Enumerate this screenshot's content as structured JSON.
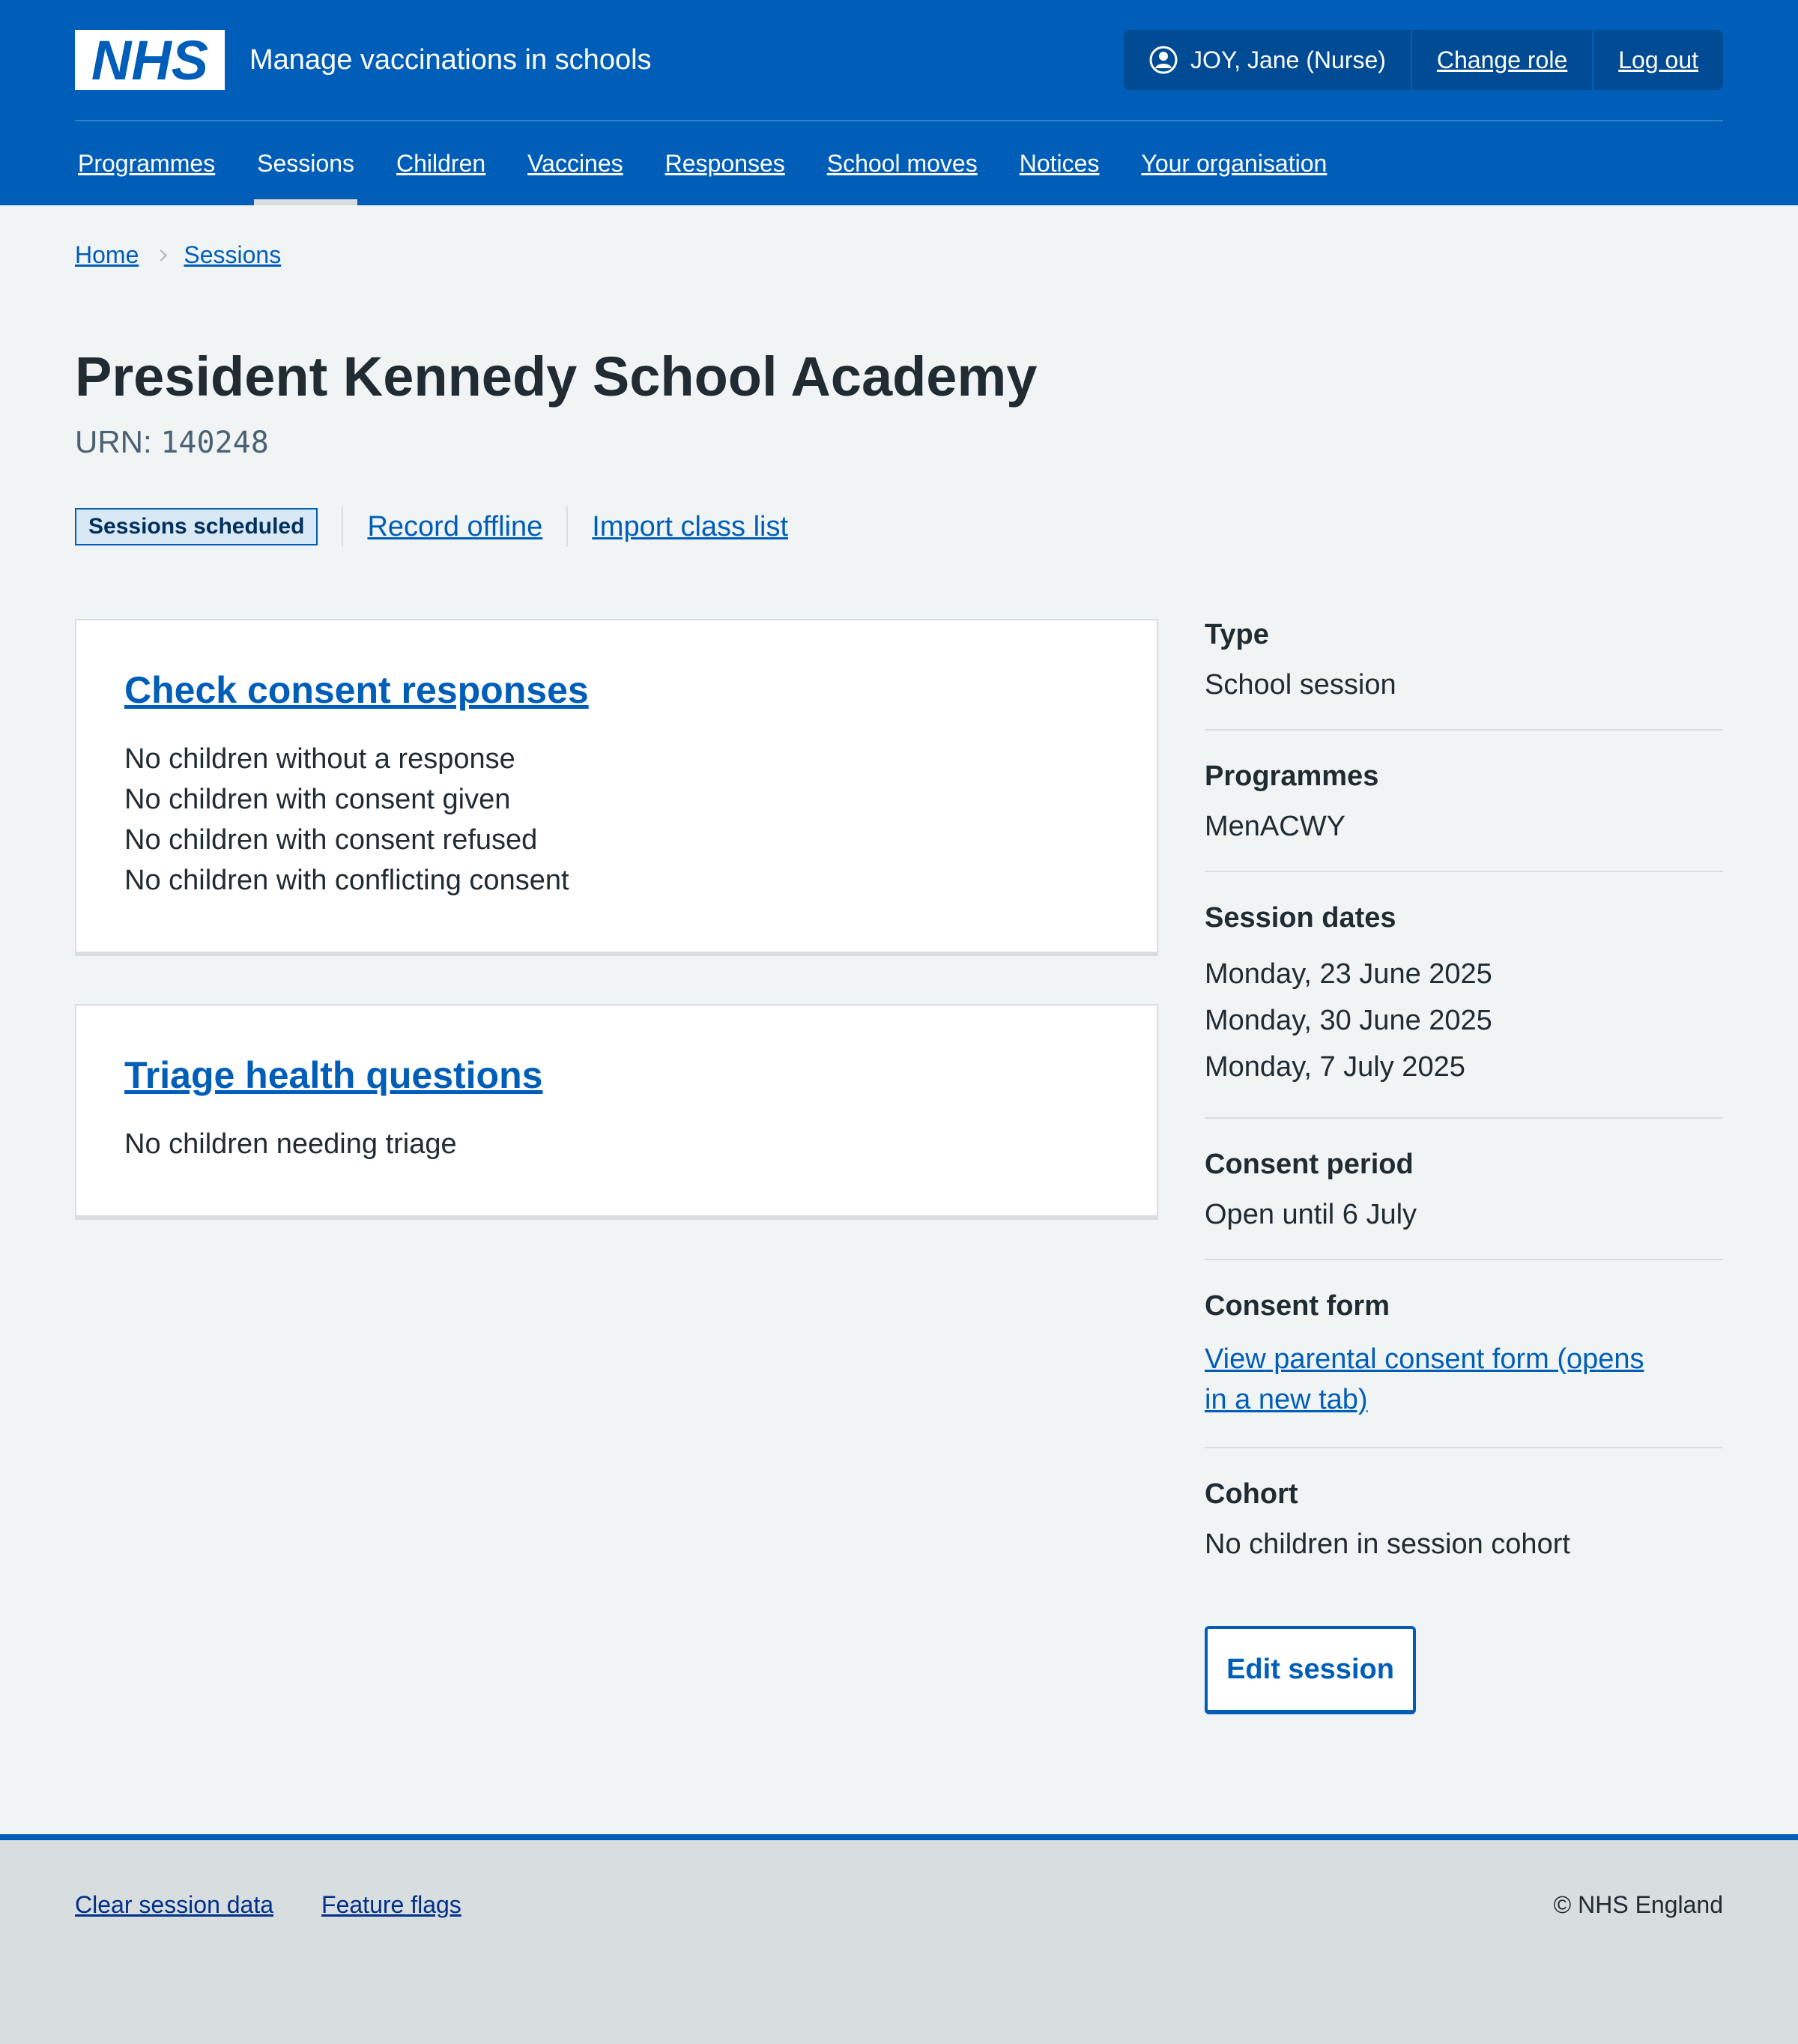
{
  "header": {
    "logo_text": "NHS",
    "service_name": "Manage vaccinations in schools",
    "account": {
      "user": "JOY, Jane (Nurse)",
      "change_role": "Change role",
      "log_out": "Log out"
    },
    "colors": {
      "brand": "#005eb8",
      "account_bg": "#004b93"
    }
  },
  "nav": {
    "items": [
      {
        "label": "Programmes"
      },
      {
        "label": "Sessions"
      },
      {
        "label": "Children"
      },
      {
        "label": "Vaccines"
      },
      {
        "label": "Responses"
      },
      {
        "label": "School moves"
      },
      {
        "label": "Notices"
      },
      {
        "label": "Your organisation"
      }
    ],
    "current": "Sessions"
  },
  "breadcrumb": [
    "Home",
    "Sessions"
  ],
  "page": {
    "title": "President Kennedy School Academy",
    "urn_label": "URN:",
    "urn_value": "140248"
  },
  "secondary_nav": {
    "current": "Sessions scheduled",
    "record_offline": "Record offline",
    "import_class_list": "Import class list"
  },
  "cards": [
    {
      "title": "Check consent responses",
      "lines": [
        "No children without a response",
        "No children with consent given",
        "No children with consent refused",
        "No children with conflicting consent"
      ]
    },
    {
      "title": "Triage health questions",
      "lines": [
        "No children needing triage"
      ]
    }
  ],
  "summary": {
    "type": {
      "key": "Type",
      "value": "School session"
    },
    "programmes": {
      "key": "Programmes",
      "value": "MenACWY"
    },
    "session_dates": {
      "key": "Session dates",
      "values": [
        "Monday, 23 June 2025",
        "Monday, 30 June 2025",
        "Monday, 7 July 2025"
      ]
    },
    "consent_period": {
      "key": "Consent period",
      "value": "Open until 6 July"
    },
    "consent_form": {
      "key": "Consent form",
      "link_line1": "View parental consent form (opens",
      "link_line2": "in a new tab)"
    },
    "cohort": {
      "key": "Cohort",
      "value": "No children in session cohort"
    }
  },
  "edit_button": "Edit session",
  "footer": {
    "links": [
      "Clear session data",
      "Feature flags"
    ],
    "copyright": "© NHS England"
  }
}
